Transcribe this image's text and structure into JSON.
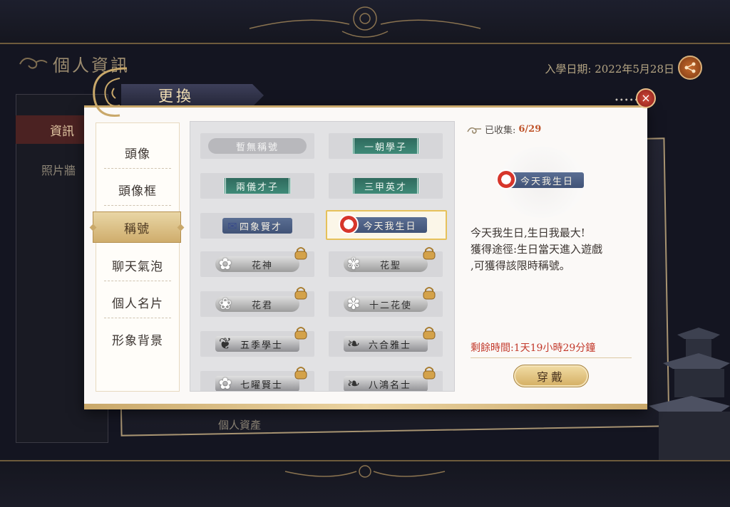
{
  "header": {
    "title": "個人資訊",
    "enroll_label": "入學日期:",
    "enroll_date": "2022年5月28日"
  },
  "background": {
    "tab_info": "資訊",
    "tab_photo": "照片牆",
    "assets": "個人資產"
  },
  "dialog": {
    "title": "更換",
    "close_icon": "×"
  },
  "categories": [
    {
      "label": "頭像"
    },
    {
      "label": "頭像框"
    },
    {
      "label": "稱號",
      "active": true
    },
    {
      "label": "聊天氣泡"
    },
    {
      "label": "個人名片"
    },
    {
      "label": "形象背景"
    }
  ],
  "titles": [
    {
      "label": "暫無稱號",
      "style": "grey"
    },
    {
      "label": "一朝學子",
      "style": "green"
    },
    {
      "label": "兩儀才子",
      "style": "green"
    },
    {
      "label": "三甲英才",
      "style": "green"
    },
    {
      "label": "四象賢才",
      "style": "blue"
    },
    {
      "label": "今天我生日",
      "style": "blue",
      "selected": true
    },
    {
      "label": "花神",
      "style": "silver",
      "locked": true
    },
    {
      "label": "花聖",
      "style": "silver",
      "locked": true
    },
    {
      "label": "花君",
      "style": "silver",
      "locked": true
    },
    {
      "label": "十二花使",
      "style": "silver",
      "locked": true
    },
    {
      "label": "五季學士",
      "style": "dark-silver",
      "locked": true
    },
    {
      "label": "六合雅士",
      "style": "dark-silver",
      "locked": true
    },
    {
      "label": "七曜賢士",
      "style": "dark-silver",
      "locked": true
    },
    {
      "label": "八鴻名士",
      "style": "dark-silver",
      "locked": true
    }
  ],
  "info": {
    "collected_label": "已收集:",
    "collected_count": "6/29",
    "preview_title": "今天我生日",
    "desc_line1": "今天我生日,生日我最大!",
    "desc_line2": "獲得途徑:生日當天進入遊戲",
    "desc_line3": ",可獲得該限時稱號。",
    "remaining": "剩餘時間:1天19小時29分鐘",
    "wear_button": "穿戴"
  },
  "colors": {
    "accent_gold": "#c9a86a",
    "remaining_red": "#c33a2c",
    "selected_border": "#e6c15a"
  }
}
